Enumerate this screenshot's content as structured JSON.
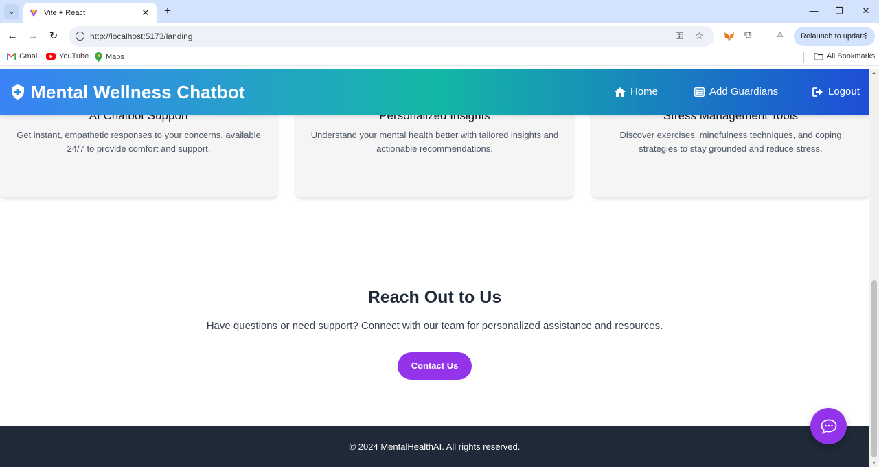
{
  "browser": {
    "tab_title": "Vite + React",
    "url": "http://localhost:5173/landing",
    "relaunch_label": "Relaunch to update",
    "bookmarks": [
      {
        "label": "Gmail",
        "icon": "gmail-icon"
      },
      {
        "label": "YouTube",
        "icon": "youtube-icon"
      },
      {
        "label": "Maps",
        "icon": "maps-icon"
      }
    ],
    "all_bookmarks_label": "All Bookmarks"
  },
  "app": {
    "brand": "Mental Wellness Chatbot",
    "brand_icon": "shield-plus-icon",
    "nav": [
      {
        "label": "Home",
        "icon": "home-icon"
      },
      {
        "label": "Add Guardians",
        "icon": "list-icon"
      },
      {
        "label": "Logout",
        "icon": "logout-icon"
      }
    ],
    "colors": {
      "nav_gradient_start": "#3b82f6",
      "nav_gradient_mid": "#14b8a6",
      "nav_gradient_end": "#1d4ed8",
      "accent_purple": "#9333ea",
      "footer_bg": "#1f2937"
    }
  },
  "features": [
    {
      "title": "AI Chatbot Support",
      "description": "Get instant, empathetic responses to your concerns, available 24/7 to provide comfort and support."
    },
    {
      "title": "Personalized Insights",
      "description": "Understand your mental health better with tailored insights and actionable recommendations."
    },
    {
      "title": "Stress Management Tools",
      "description": "Discover exercises, mindfulness techniques, and coping strategies to stay grounded and reduce stress."
    }
  ],
  "contact": {
    "title": "Reach Out to Us",
    "subtitle": "Have questions or need support? Connect with our team for personalized assistance and resources.",
    "button_label": "Contact Us"
  },
  "footer": {
    "text": "© 2024 MentalHealthAI. All rights reserved."
  }
}
